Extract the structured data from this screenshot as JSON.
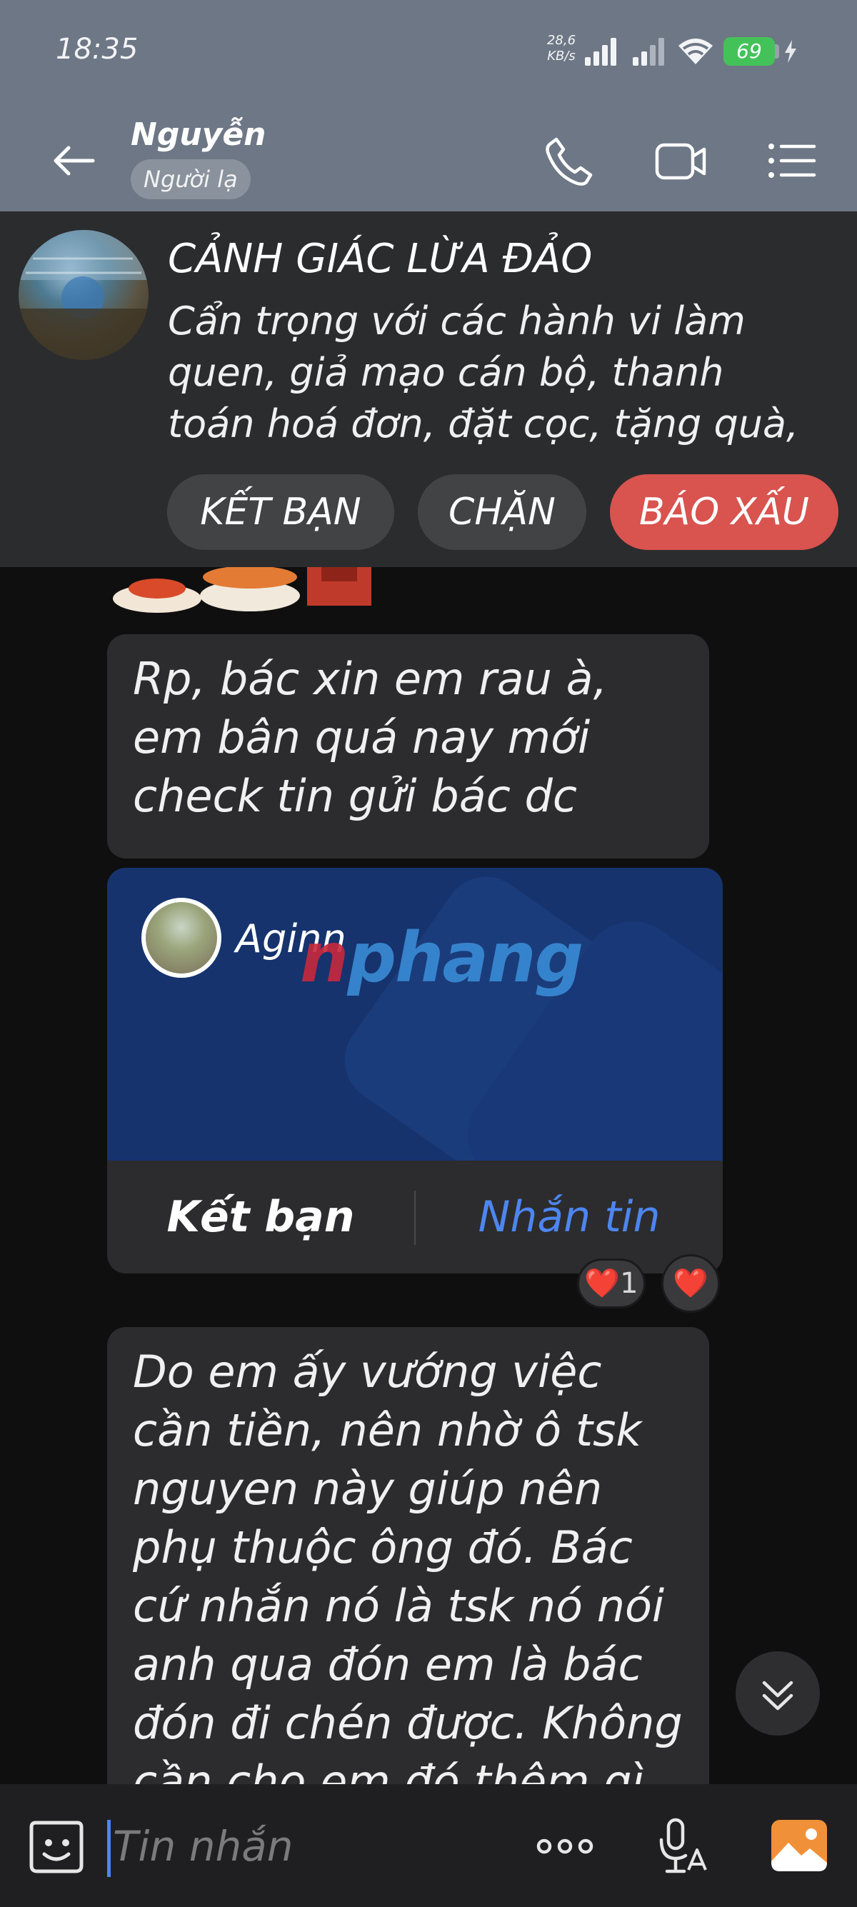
{
  "status_bar": {
    "time": "18:35",
    "net_speed_value": "28,6",
    "net_speed_unit": "KB/s",
    "battery_level": "69"
  },
  "header": {
    "contact_name": "Nguyễn",
    "stranger_label": "Người lạ",
    "icons": [
      "back-arrow-icon",
      "phone-icon",
      "video-call-icon",
      "menu-icon"
    ]
  },
  "warning": {
    "title": "CẢNH GIÁC LỪA ĐẢO",
    "body": "Cẩn trọng với các hành vi làm quen, giả mạo cán bộ, thanh toán hoá đơn, đặt cọc, tặng quà,",
    "add_friend_label": "KẾT BẠN",
    "block_label": "CHẶN",
    "report_label": "BÁO XẤU",
    "report_color": "#d9534f"
  },
  "messages": {
    "first_text": "Rp, bác xin em rau à, em bân quá nay mới check tin gửi bác dc",
    "contact_card": {
      "name": "Aginn",
      "add_friend_label": "Kết bạn",
      "message_label": "Nhắn tin"
    },
    "reactions": {
      "count_label": "❤️1",
      "quick_heart": "❤️"
    },
    "second_text": "Do em ấy vướng việc cần tiền, nên nhờ ô tsk nguyen này giúp nên phụ thuộc ông đó. Bác cứ nhắn nó là tsk nó nói anh qua đón em là bác đón đi chén được. Không cần cho em đó thêm gì"
  },
  "watermark": {
    "first_letter": "n",
    "rest": "phang"
  },
  "input_bar": {
    "placeholder": "Tin nhắn",
    "icons": [
      "emoji-icon",
      "more-icon",
      "voice-icon",
      "image-icon"
    ]
  },
  "colors": {
    "header_bg": "#6e7785",
    "accent_blue": "#4d86f0",
    "battery_green": "#44c25a"
  }
}
